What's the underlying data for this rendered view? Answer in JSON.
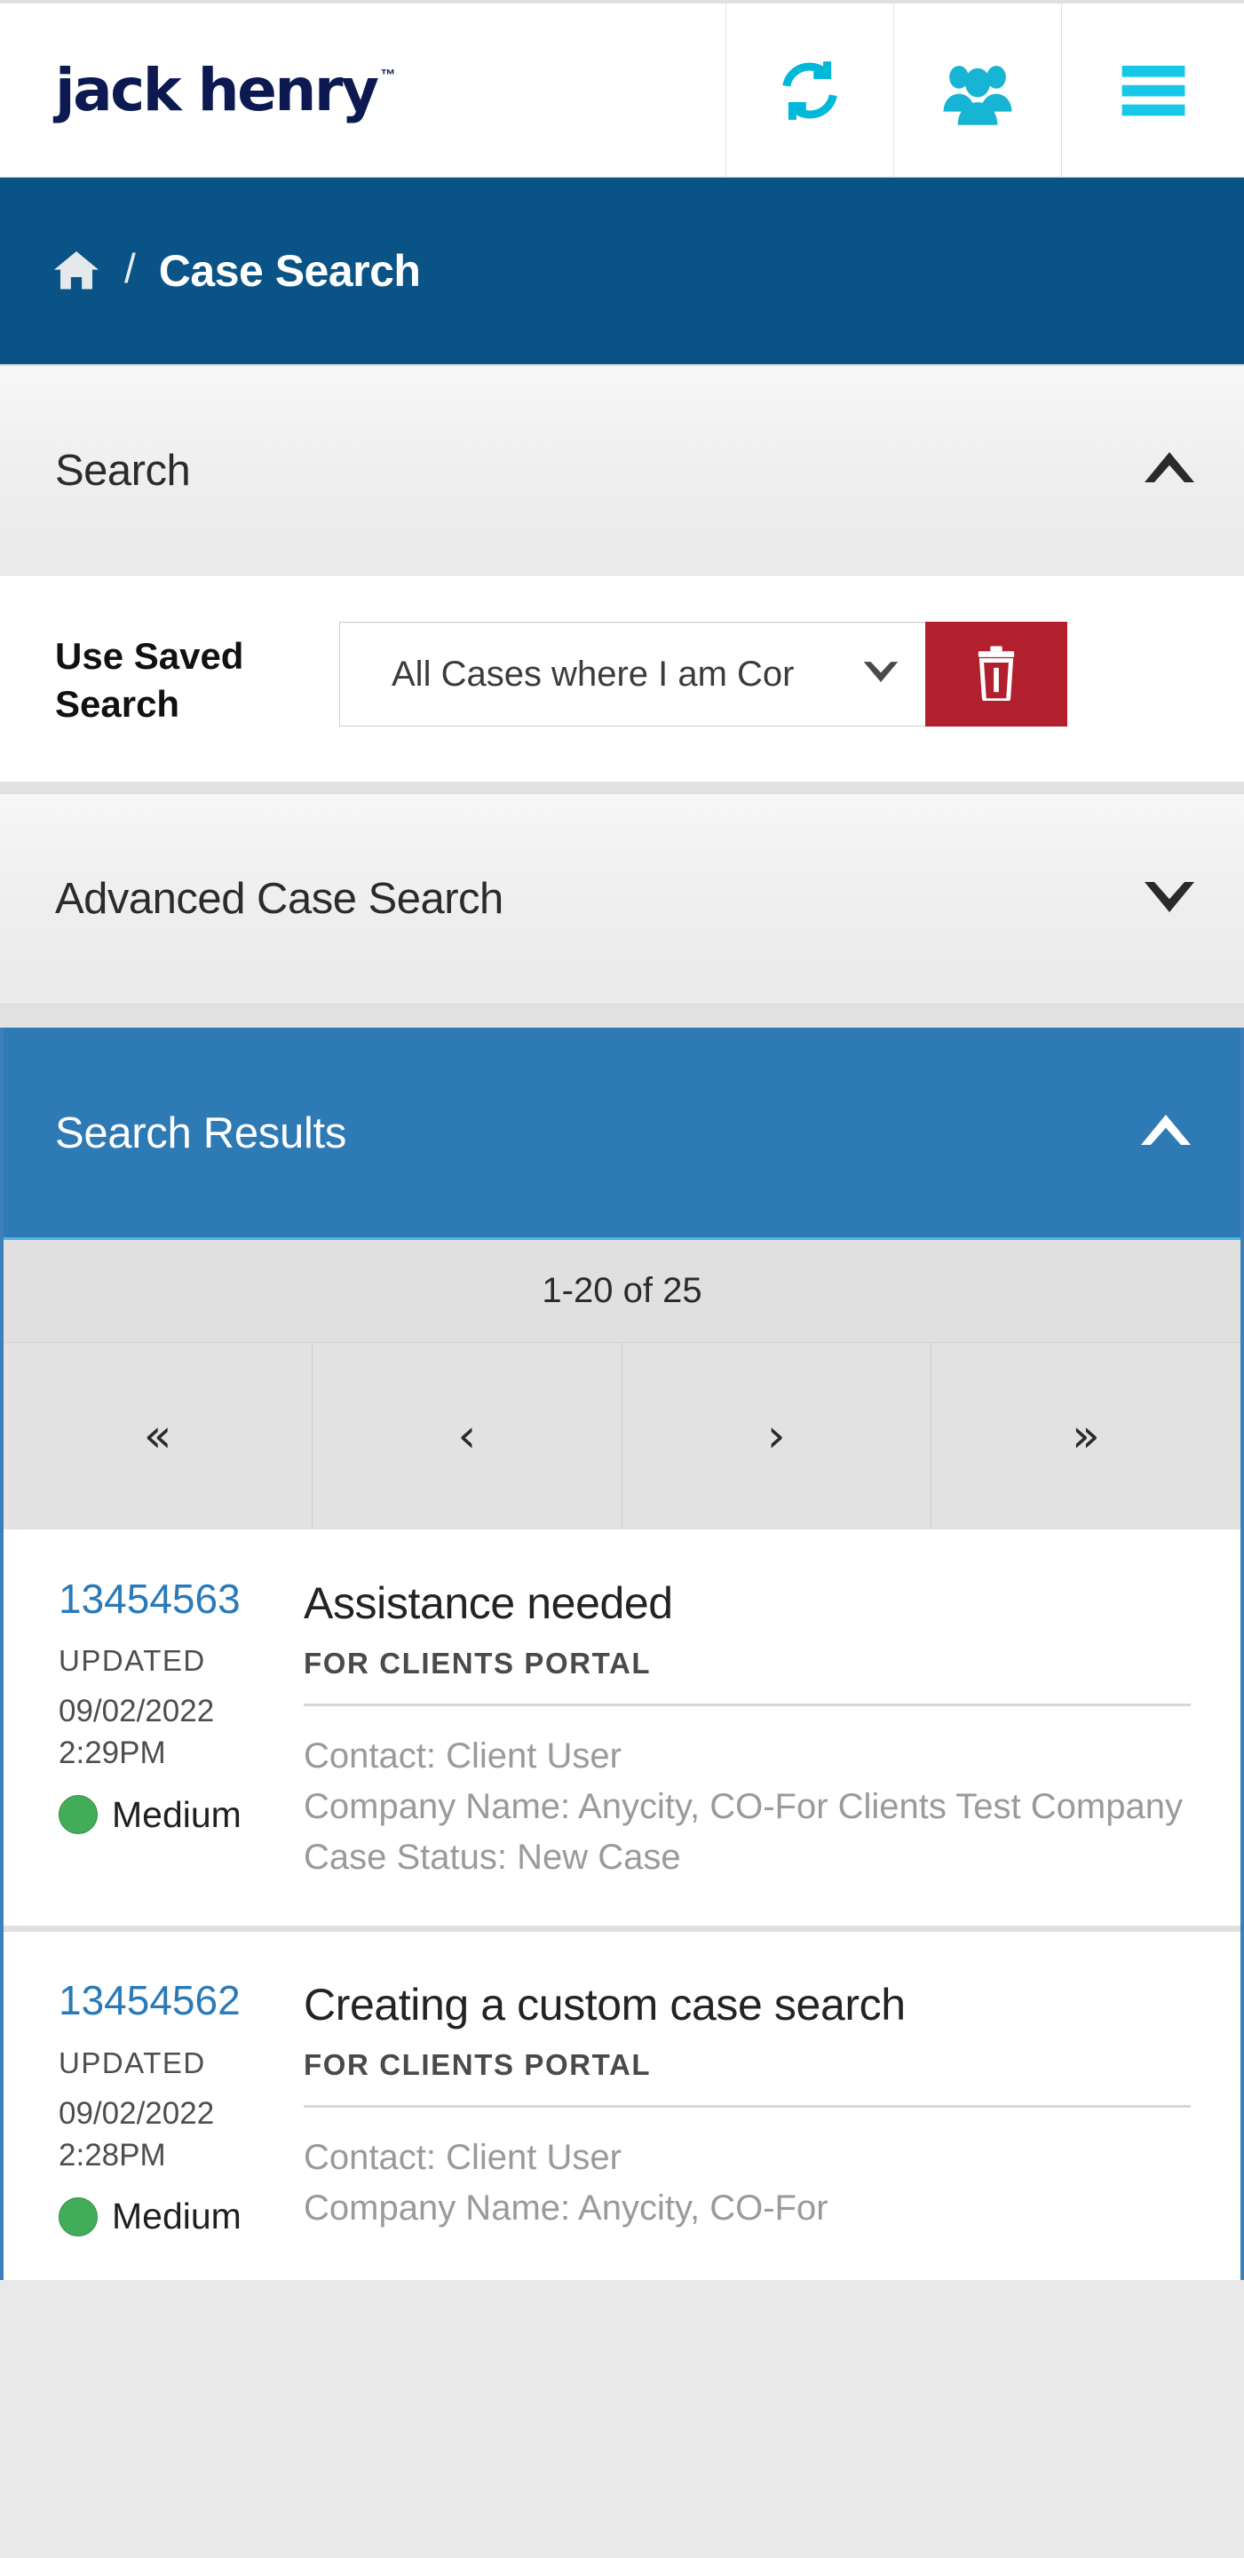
{
  "appbar": {
    "brand_name": "jack henry",
    "brand_tm": "™",
    "buttons": [
      {
        "name": "refresh",
        "icon": "refresh-icon"
      },
      {
        "name": "users",
        "icon": "users-icon"
      },
      {
        "name": "menu",
        "icon": "hamburger-menu-icon"
      }
    ]
  },
  "breadcrumb": {
    "home_icon": "home-icon",
    "separator": "/",
    "title": "Case Search"
  },
  "search_panel": {
    "title": "Search",
    "collapse_icon": "chevron-up-icon",
    "saved_search_label": "Use Saved Search",
    "saved_search_value": "All Cases where I am Cor",
    "saved_search_caret": "chevron-down-icon",
    "delete_icon": "trash-icon"
  },
  "advanced_panel": {
    "title": "Advanced Case Search",
    "expand_icon": "chevron-down-icon"
  },
  "results_panel": {
    "title": "Search Results",
    "collapse_icon": "chevron-up-icon",
    "pagination": {
      "count_text": "1-20 of 25",
      "first_label": "«",
      "prev_label": "‹",
      "next_label": "›",
      "last_label": "»"
    },
    "cards": [
      {
        "case_number": "13454563",
        "updated_label": "UPDATED",
        "updated_value": "09/02/2022 2:29PM",
        "priority": "Medium",
        "priority_color": "#41ad58",
        "subject": "Assistance needed",
        "product": "FOR CLIENTS PORTAL",
        "contact": "Contact: Client User",
        "company": "Company Name: Anycity, CO-For Clients Test Company",
        "status": "Case Status: New Case"
      },
      {
        "case_number": "13454562",
        "updated_label": "UPDATED",
        "updated_value": "09/02/2022 2:28PM",
        "priority": "Medium",
        "priority_color": "#41ad58",
        "subject": "Creating a custom case search",
        "product": "FOR CLIENTS PORTAL",
        "contact": "Contact: Client User",
        "company": "Company Name: Anycity, CO-For",
        "status": ""
      }
    ]
  },
  "colors": {
    "brand_navy": "#0d1a52",
    "brand_cyan": "#00bcd4",
    "breadcrumb_blue": "#0a5387",
    "results_blue": "#2e7ab5",
    "link_blue": "#2a7ab9",
    "danger_red": "#b21f2d"
  }
}
